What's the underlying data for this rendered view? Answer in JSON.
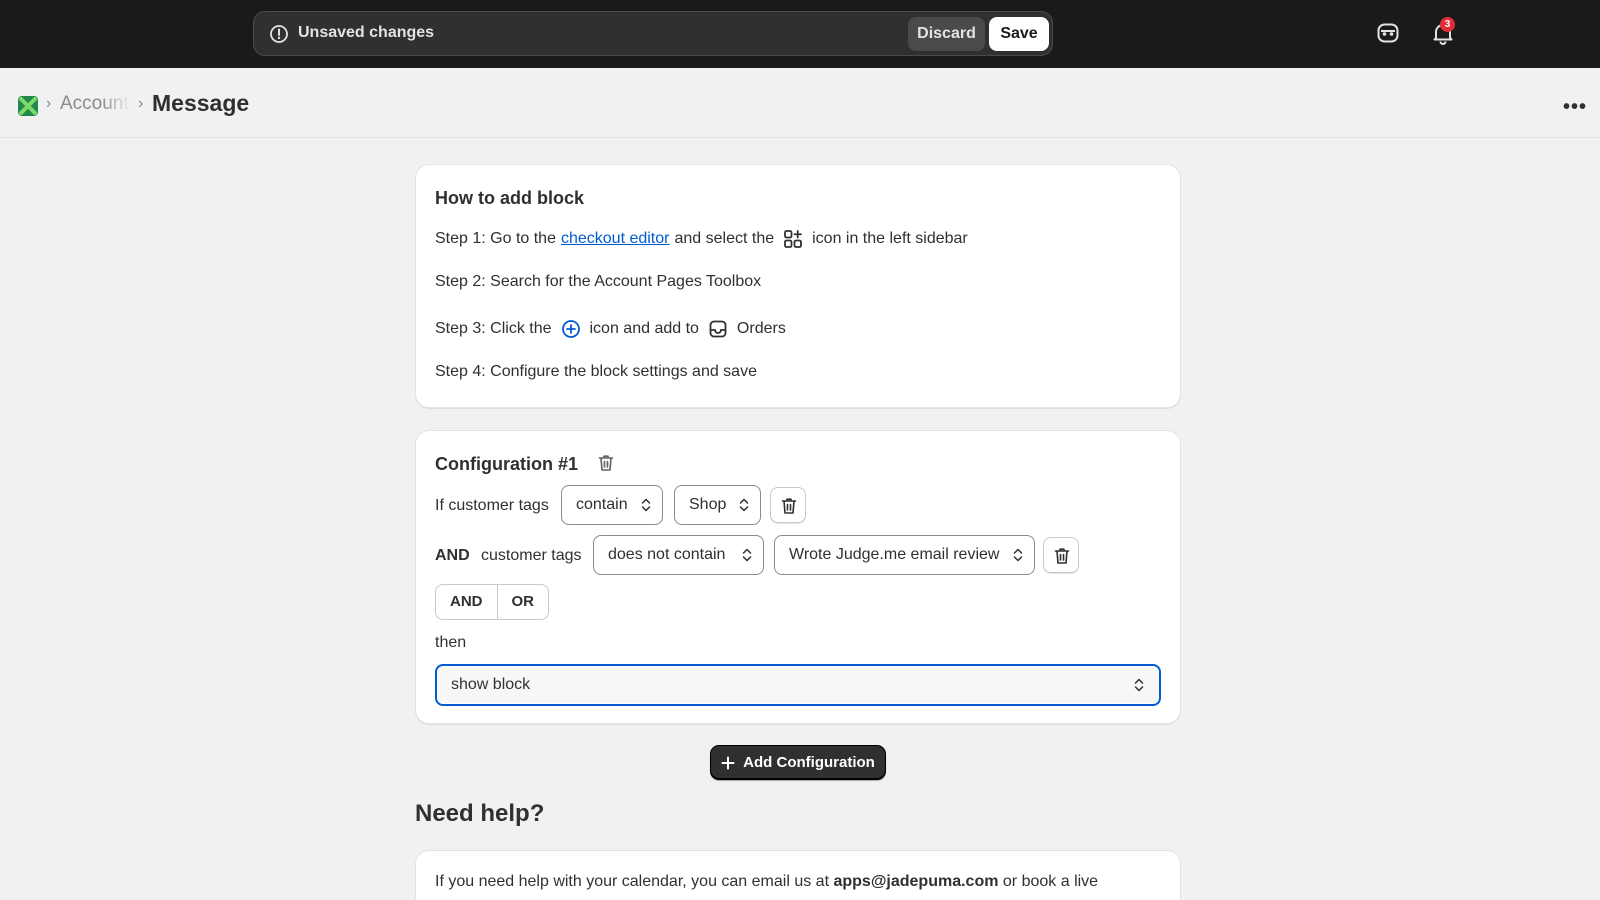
{
  "topbar": {
    "unsaved_message": "Unsaved changes",
    "discard_label": "Discard",
    "save_label": "Save",
    "notification_count": "3"
  },
  "breadcrumb": {
    "parent": "Account",
    "current": "Message"
  },
  "how_to": {
    "title": "How to add block",
    "step1_prefix": "Step 1: Go to the",
    "step1_link": "checkout editor",
    "step1_mid": "and select the",
    "step1_suffix": "icon in the left sidebar",
    "step2": "Step 2: Search for the Account Pages Toolbox",
    "step3_prefix": "Step 3: Click the",
    "step3_mid": "icon and add to",
    "step3_suffix": "Orders",
    "step4": "Step 4: Configure the block settings and save"
  },
  "configuration": {
    "title": "Configuration #1",
    "condition1": {
      "label": "If customer tags",
      "operator": "contain",
      "value": "Shop"
    },
    "condition2": {
      "joiner": "AND",
      "label": "customer tags",
      "operator": "does not contain",
      "value": "Wrote Judge.me email review"
    },
    "logic_buttons": [
      "AND",
      "OR"
    ],
    "then_label": "then",
    "action": "show block"
  },
  "add_configuration_label": "Add Configuration",
  "help": {
    "title": "Need help?",
    "text_prefix": "If you need help with your calendar, you can email us at",
    "email": "apps@jadepuma.com",
    "text_suffix": "or book a live"
  },
  "colors": {
    "accent": "#005bd3",
    "topbar": "#1a1a1a",
    "badge": "#e22c38"
  }
}
